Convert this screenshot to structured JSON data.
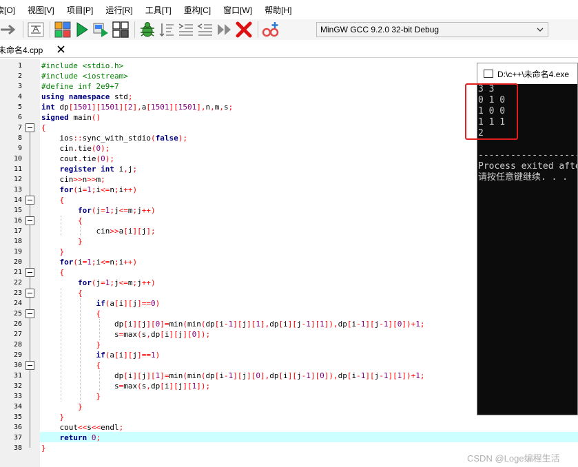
{
  "menubar": {
    "items": [
      "索[O]",
      "视图[V]",
      "项目[P]",
      "运行[R]",
      "工具[T]",
      "重构[C]",
      "窗口[W]",
      "帮助[H]"
    ]
  },
  "toolbar": {
    "compiler": "MinGW GCC 9.2.0 32-bit Debug",
    "icons": [
      "redo-icon",
      "text-format-icon",
      "grid-icon",
      "run-icon",
      "compile-run-icon",
      "layout-icon",
      "debug-bug-icon",
      "sort-icon",
      "indent-icon",
      "unindent-icon",
      "next-icon",
      "stop-icon",
      "profile-icon",
      "add-watch-icon"
    ]
  },
  "tabs": [
    {
      "label": "未命名4.cpp",
      "active": true
    }
  ],
  "editor": {
    "highlighted_line": 37,
    "line_numbers": [
      "1",
      "2",
      "3",
      "4",
      "5",
      "6",
      "7",
      "8",
      "9",
      "10",
      "11",
      "12",
      "13",
      "14",
      "15",
      "16",
      "17",
      "18",
      "19",
      "20",
      "21",
      "22",
      "23",
      "24",
      "25",
      "26",
      "27",
      "28",
      "29",
      "30",
      "31",
      "32",
      "33",
      "34",
      "35",
      "36",
      "37",
      "38"
    ],
    "lines": [
      "#include <stdio.h>",
      "#include <iostream>",
      "#define inf 2e9+7",
      "using namespace std;",
      "int dp[1501][1501][2],a[1501][1501],n,m,s;",
      "signed main()",
      "{",
      "    ios::sync_with_stdio(false);",
      "    cin.tie(0);",
      "    cout.tie(0);",
      "    register int i,j;",
      "    cin>>n>>m;",
      "    for(i=1;i<=n;i++)",
      "    {",
      "        for(j=1;j<=m;j++)",
      "        {",
      "            cin>>a[i][j];",
      "        }",
      "    }",
      "    for(i=1;i<=n;i++)",
      "    {",
      "        for(j=1;j<=m;j++)",
      "        {",
      "            if(a[i][j]==0)",
      "            {",
      "                dp[i][j][0]=min(min(dp[i-1][j][1],dp[i][j-1][1]),dp[i-1][j-1][0])+1;",
      "                s=max(s,dp[i][j][0]);",
      "            }",
      "            if(a[i][j]==1)",
      "            {",
      "                dp[i][j][1]=min(min(dp[i-1][j][0],dp[i][j-1][0]),dp[i-1][j-1][1])+1;",
      "                s=max(s,dp[i][j][1]);",
      "            }",
      "        }",
      "    }",
      "    cout<<s<<endl;",
      "    return 0;",
      "}"
    ]
  },
  "console": {
    "title": "D:\\c++\\未命名4.exe",
    "lines": [
      "3 3",
      "0 1 0",
      "1 0 0",
      "1 1 1",
      "2",
      "",
      "--------------------------------",
      "Process exited after",
      "请按任意键继续. . ."
    ]
  },
  "watermark": "CSDN @Loge编程生活",
  "colors": {
    "keyword": "#000080",
    "preprocessor": "#008000",
    "number": "#800080",
    "symbol": "#ff0000",
    "current_line": "#ccffff",
    "annotation_box": "#e02020"
  }
}
